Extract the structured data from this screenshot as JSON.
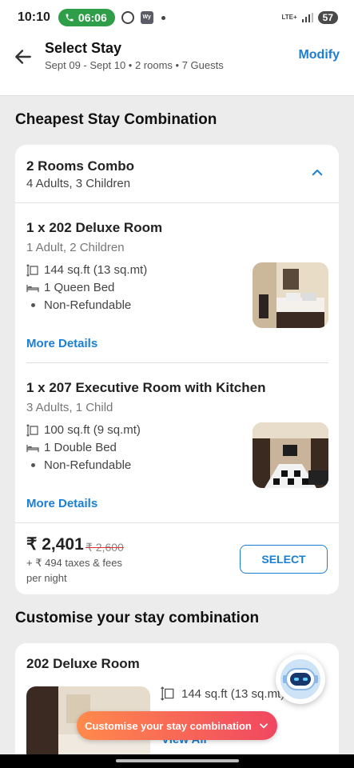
{
  "status_bar": {
    "time": "10:10",
    "call_timer": "06:06",
    "network": "LTE+",
    "battery": "57"
  },
  "header": {
    "title": "Select Stay",
    "subtitle": "Sept 09 - Sept 10 • 2 rooms • 7 Guests",
    "modify_label": "Modify"
  },
  "cheapest": {
    "section_title": "Cheapest Stay Combination",
    "combo_title": "2 Rooms Combo",
    "combo_guests": "4 Adults, 3 Children",
    "rooms": [
      {
        "name": "1 x 202 Deluxe Room",
        "occupancy": "1 Adult, 2 Children",
        "area": "144 sq.ft (13 sq.mt)",
        "bed": "1 Queen Bed",
        "policy": "Non-Refundable",
        "more_label": "More Details"
      },
      {
        "name": "1 x 207 Executive Room with Kitchen",
        "occupancy": "3 Adults, 1 Child",
        "area": "100 sq.ft (9 sq.mt)",
        "bed": "1 Double Bed",
        "policy": "Non-Refundable",
        "more_label": "More Details"
      }
    ],
    "price": "₹ 2,401",
    "original_price": "₹ 2,600",
    "taxes": "+ ₹ 494 taxes & fees per night",
    "select_label": "SELECT"
  },
  "customise": {
    "section_title": "Customise your stay combination",
    "room_title": "202 Deluxe Room",
    "area": "144 sq.ft (13 sq.mt)",
    "view_all": "View All",
    "fab_label": "Customise your stay combination"
  },
  "colors": {
    "accent": "#1a7fd4",
    "call_green": "#2e9e48",
    "fab_gradient_start": "#ff8a4c",
    "fab_gradient_end": "#f04761"
  }
}
